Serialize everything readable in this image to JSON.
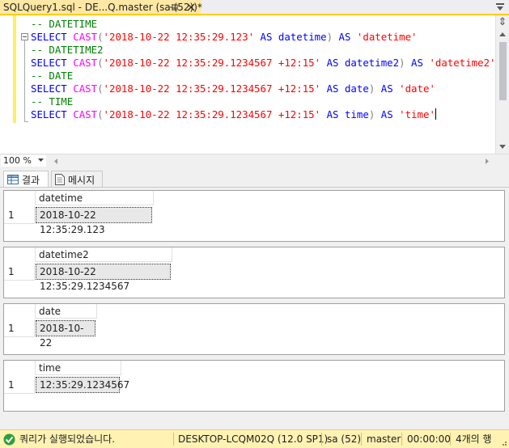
{
  "tab": {
    "title": "SQLQuery1.sql - DE...Q.master (sa (52))*"
  },
  "editor": {
    "lines": [
      [
        {
          "t": "-- DATETIME",
          "c": "cm"
        }
      ],
      [
        {
          "t": "SELECT",
          "c": "kw"
        },
        {
          "t": " ",
          "c": "id"
        },
        {
          "t": "CAST",
          "c": "fn"
        },
        {
          "t": "(",
          "c": "pn"
        },
        {
          "t": "'2018-10-22 12:35:29.123'",
          "c": "str"
        },
        {
          "t": " ",
          "c": "id"
        },
        {
          "t": "AS",
          "c": "kw"
        },
        {
          "t": " ",
          "c": "id"
        },
        {
          "t": "datetime",
          "c": "kw"
        },
        {
          "t": ")",
          "c": "pn"
        },
        {
          "t": " ",
          "c": "id"
        },
        {
          "t": "AS",
          "c": "kw"
        },
        {
          "t": " ",
          "c": "id"
        },
        {
          "t": "'datetime'",
          "c": "str"
        }
      ],
      [
        {
          "t": "-- DATETIME2",
          "c": "cm"
        }
      ],
      [
        {
          "t": "SELECT",
          "c": "kw"
        },
        {
          "t": " ",
          "c": "id"
        },
        {
          "t": "CAST",
          "c": "fn"
        },
        {
          "t": "(",
          "c": "pn"
        },
        {
          "t": "'2018-10-22 12:35:29.1234567 +12:15'",
          "c": "str"
        },
        {
          "t": " ",
          "c": "id"
        },
        {
          "t": "AS",
          "c": "kw"
        },
        {
          "t": " ",
          "c": "id"
        },
        {
          "t": "datetime2",
          "c": "kw"
        },
        {
          "t": ")",
          "c": "pn"
        },
        {
          "t": " ",
          "c": "id"
        },
        {
          "t": "AS",
          "c": "kw"
        },
        {
          "t": " ",
          "c": "id"
        },
        {
          "t": "'datetime2'",
          "c": "str"
        }
      ],
      [
        {
          "t": "-- DATE",
          "c": "cm"
        }
      ],
      [
        {
          "t": "SELECT",
          "c": "kw"
        },
        {
          "t": " ",
          "c": "id"
        },
        {
          "t": "CAST",
          "c": "fn"
        },
        {
          "t": "(",
          "c": "pn"
        },
        {
          "t": "'2018-10-22 12:35:29.1234567 +12:15'",
          "c": "str"
        },
        {
          "t": " ",
          "c": "id"
        },
        {
          "t": "AS",
          "c": "kw"
        },
        {
          "t": " ",
          "c": "id"
        },
        {
          "t": "date",
          "c": "kw"
        },
        {
          "t": ")",
          "c": "pn"
        },
        {
          "t": " ",
          "c": "id"
        },
        {
          "t": "AS",
          "c": "kw"
        },
        {
          "t": " ",
          "c": "id"
        },
        {
          "t": "'date'",
          "c": "str"
        }
      ],
      [
        {
          "t": "-- TIME",
          "c": "cm"
        }
      ],
      [
        {
          "t": "SELECT",
          "c": "kw"
        },
        {
          "t": " ",
          "c": "id"
        },
        {
          "t": "CAST",
          "c": "fn"
        },
        {
          "t": "(",
          "c": "pn"
        },
        {
          "t": "'2018-10-22 12:35:29.1234567 +12:15'",
          "c": "str"
        },
        {
          "t": " ",
          "c": "id"
        },
        {
          "t": "AS",
          "c": "kw"
        },
        {
          "t": " ",
          "c": "id"
        },
        {
          "t": "time",
          "c": "kw"
        },
        {
          "t": ")",
          "c": "pn"
        },
        {
          "t": " ",
          "c": "id"
        },
        {
          "t": "AS",
          "c": "kw"
        },
        {
          "t": " ",
          "c": "id"
        },
        {
          "t": "'time'",
          "c": "str"
        }
      ]
    ]
  },
  "zoom": {
    "value": "100 %"
  },
  "result_tabs": {
    "results_label": "결과",
    "messages_label": "메시지"
  },
  "results": [
    {
      "column": "datetime",
      "row_number": "1",
      "value": "2018-10-22 12:35:29.123"
    },
    {
      "column": "datetime2",
      "row_number": "1",
      "value": "2018-10-22 12:35:29.1234567"
    },
    {
      "column": "date",
      "row_number": "1",
      "value": "2018-10-22"
    },
    {
      "column": "time",
      "row_number": "1",
      "value": "12:35:29.1234567"
    }
  ],
  "status": {
    "message": "쿼리가 실행되었습니다.",
    "server": "DESKTOP-LCQM02Q (12.0 SP1)",
    "user": "sa (52)",
    "database": "master",
    "elapsed": "00:00:00",
    "rows": "4개의 행"
  },
  "colors": {
    "tab_active": "#ffe8a6",
    "status_bar": "#fff2b3",
    "keyword": "#0000ff",
    "function": "#ff00ff",
    "string": "#ff0000",
    "comment": "#008000"
  }
}
